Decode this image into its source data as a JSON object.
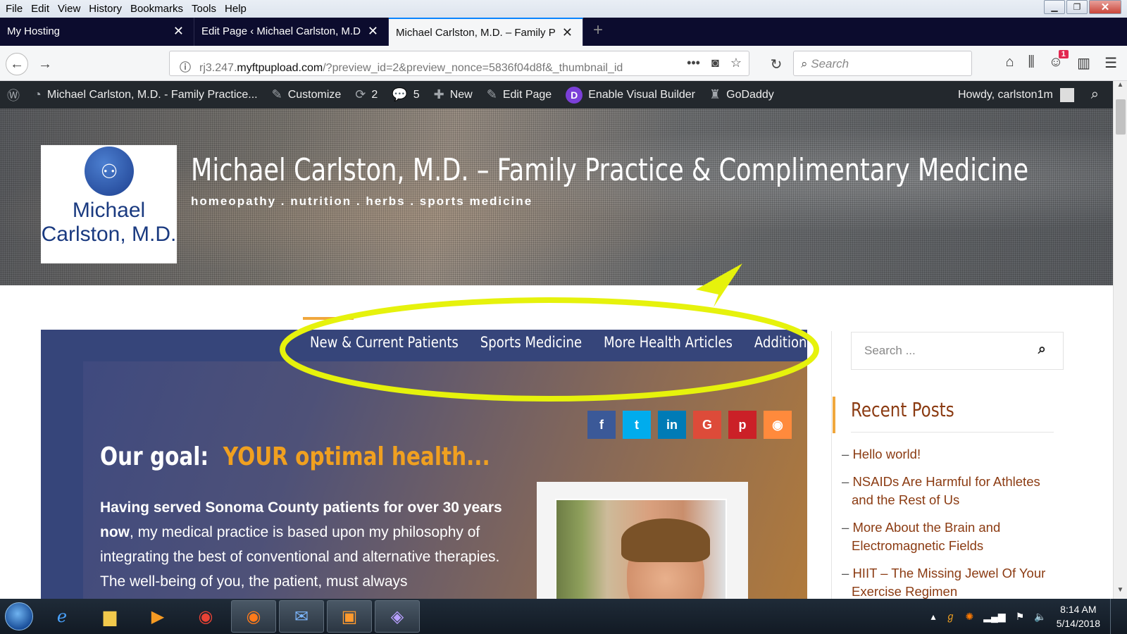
{
  "menubar": {
    "items": [
      "File",
      "Edit",
      "View",
      "History",
      "Bookmarks",
      "Tools",
      "Help"
    ]
  },
  "tabs": [
    {
      "label": "My Hosting"
    },
    {
      "label": "Edit Page ‹ Michael Carlston, M.D. -"
    },
    {
      "label": "Michael Carlston, M.D. – Family Prac"
    }
  ],
  "urlbar": {
    "prefix": "rj3.247.",
    "domain": "myftpupload.com",
    "path": "/?preview_id=2&preview_nonce=5836f04d8f&_thumbnail_id"
  },
  "searchbar": {
    "placeholder": "Search"
  },
  "notification_count": "1",
  "wpbar": {
    "site": "Michael Carlston, M.D. - Family Practice...",
    "customize": "Customize",
    "updates": "2",
    "comments": "5",
    "new": "New",
    "edit_page": "Edit Page",
    "divi_letter": "D",
    "visual_builder": "Enable Visual Builder",
    "godaddy": "GoDaddy",
    "howdy": "Howdy, carlston1m"
  },
  "site": {
    "logo_text_1": "Michael",
    "logo_text_2": "Carlston, M.D.",
    "title": "Michael Carlston, M.D. – Family Practice & Complimentary Medicine",
    "tagline": "homeopathy . nutrition . herbs . sports medicine"
  },
  "nav": [
    "New & Current Patients",
    "Sports Medicine",
    "More Health Articles",
    "Additional Re"
  ],
  "social": [
    {
      "icon": "facebook-icon",
      "glyph": "f",
      "color": "#3b5998"
    },
    {
      "icon": "twitter-icon",
      "glyph": "t",
      "color": "#00aced"
    },
    {
      "icon": "linkedin-icon",
      "glyph": "in",
      "color": "#007bb6"
    },
    {
      "icon": "google-plus-icon",
      "glyph": "G",
      "color": "#dd4b39"
    },
    {
      "icon": "pinterest-icon",
      "glyph": "p",
      "color": "#cb2027"
    },
    {
      "icon": "rss-icon",
      "glyph": "◉",
      "color": "#ff8a3c"
    }
  ],
  "content": {
    "goal_prefix": "Our goal:",
    "goal_highlight": "YOUR optimal health...",
    "body_bold": "Having served Sonoma County patients for over 30 years now",
    "body_rest": ", my medical practice is based upon my philosophy of integrating the best of conventional and alternative therapies. The well-being of you, the patient, must always"
  },
  "sidebar": {
    "search_placeholder": "Search ...",
    "recent_title": "Recent Posts",
    "posts": [
      "Hello world!",
      "NSAIDs Are Harmful for Athletes and the Rest of Us",
      "More About the Brain and Electromagnetic Fields",
      "HIIT – The Missing Jewel Of Your Exercise Regimen"
    ]
  },
  "taskbar": {
    "time": "8:14 AM",
    "date": "5/14/2018"
  },
  "colors": {
    "accent": "#f0a73d",
    "link": "#8b3b12",
    "annotation": "#e6f20c"
  }
}
